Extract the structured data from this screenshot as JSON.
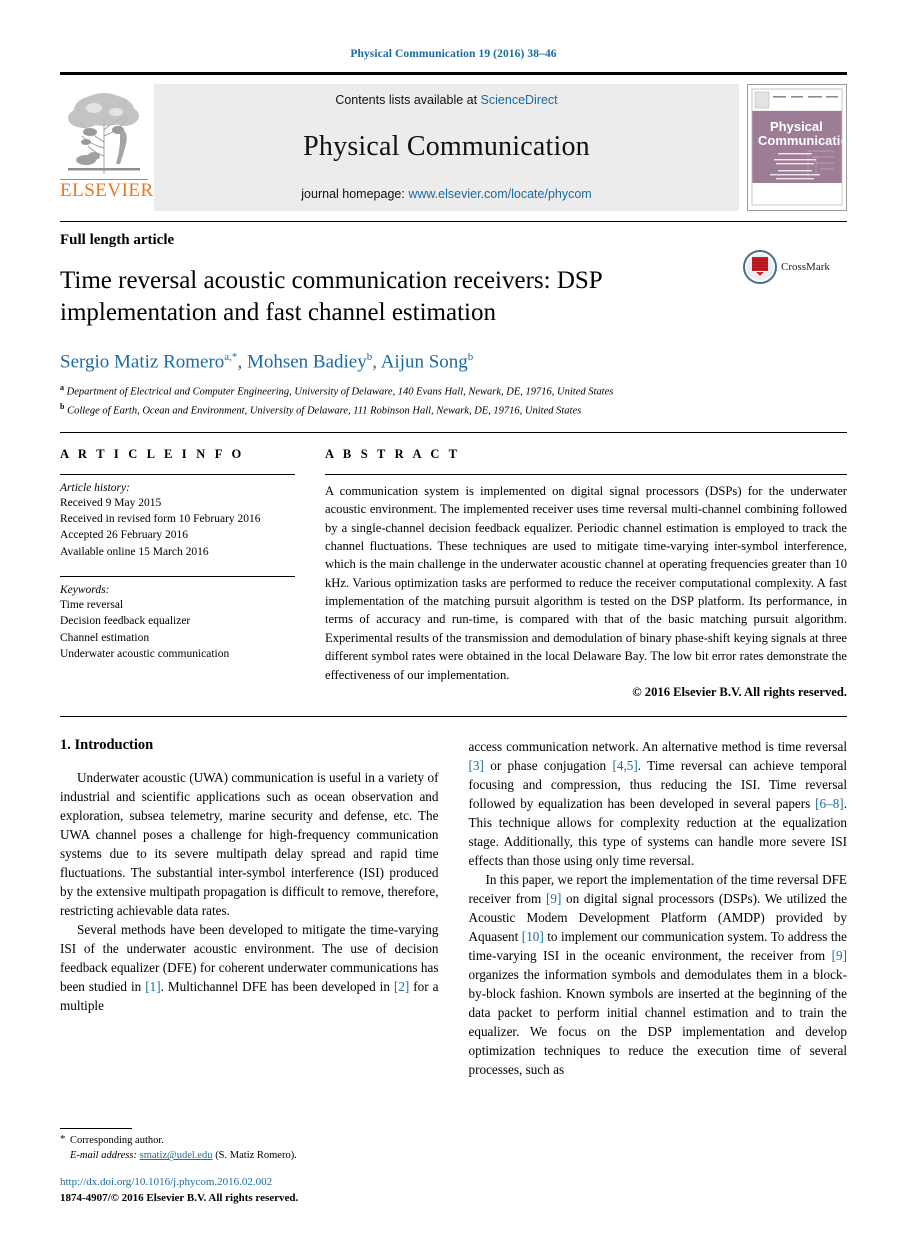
{
  "running_head": "Physical Communication 19 (2016) 38–46",
  "masthead": {
    "publisher_name": "ELSEVIER",
    "contents_prefix": "Contents lists available at ",
    "contents_link": "ScienceDirect",
    "journal_title": "Physical Communication",
    "homepage_prefix": "journal homepage: ",
    "homepage_link": "www.elsevier.com/locate/phycom",
    "cover_title_line1": "Physical",
    "cover_title_line2": "Communication"
  },
  "title_block": {
    "article_type": "Full length article",
    "title": "Time reversal acoustic communication receivers: DSP implementation and fast channel estimation",
    "crossmark_label": "CrossMark",
    "authors": "Sergio Matiz Romero",
    "author2": "Mohsen Badiey",
    "author3": "Aijun Song",
    "affiliation_a": "Department of Electrical and Computer Engineering, University of Delaware, 140 Evans Hall, Newark, DE, 19716, United States",
    "affiliation_b": "College of Earth, Ocean and Environment, University of Delaware, 111 Robinson Hall, Newark, DE, 19716, United States"
  },
  "article_info": {
    "heading": "A R T I C L E   I N F O",
    "history_label": "Article history:",
    "history": [
      "Received 9 May 2015",
      "Received in revised form 10 February 2016",
      "Accepted 26 February 2016",
      "Available online 15 March 2016"
    ],
    "keywords_label": "Keywords:",
    "keywords": [
      "Time reversal",
      "Decision feedback equalizer",
      "Channel estimation",
      "Underwater acoustic communication"
    ]
  },
  "abstract": {
    "heading": "A B S T R A C T",
    "text": "A communication system is implemented on digital signal processors (DSPs) for the underwater acoustic environment. The implemented receiver uses time reversal multi-channel combining followed by a single-channel decision feedback equalizer. Periodic channel estimation is employed to track the channel fluctuations. These techniques are used to mitigate time-varying inter-symbol interference, which is the main challenge in the underwater acoustic channel at operating frequencies greater than 10 kHz. Various optimization tasks are performed to reduce the receiver computational complexity. A fast implementation of the matching pursuit algorithm is tested on the DSP platform. Its performance, in terms of accuracy and run-time, is compared with that of the basic matching pursuit algorithm. Experimental results of the transmission and demodulation of binary phase-shift keying signals at three different symbol rates were obtained in the local Delaware Bay. The low bit error rates demonstrate the effectiveness of our implementation.",
    "copyright": "© 2016 Elsevier B.V. All rights reserved."
  },
  "body": {
    "section_heading": "1. Introduction",
    "left_para1_a": "Underwater acoustic (UWA) communication is useful in a variety of industrial and scientific applications such as ocean observation and exploration, subsea telemetry, marine security and defense, etc. The UWA channel poses a challenge for high-frequency communication systems due to its severe multipath delay spread and rapid time fluctuations. The substantial inter-symbol interference (ISI) produced by the extensive multipath propagation is difficult to remove, therefore, restricting achievable data rates.",
    "left_para2_a": "Several methods have been developed to mitigate the time-varying ISI of the underwater acoustic environment. The use of decision feedback equalizer (DFE) for coherent underwater communications has been studied in ",
    "left_cite1": "[1]",
    "left_para2_b": ". Multichannel DFE has been developed in ",
    "left_cite2": "[2]",
    "left_para2_c": " for a multiple",
    "right_para1_a": "access communication network. An alternative method is time reversal ",
    "right_cite3": "[3]",
    "right_para1_b": " or phase conjugation ",
    "right_cite45": "[4,5]",
    "right_para1_c": ". Time reversal can achieve temporal focusing and compression, thus reducing the ISI. Time reversal followed by equalization has been developed in several papers ",
    "right_cite68": "[6–8]",
    "right_para1_d": ". This technique allows for complexity reduction at the equalization stage. Additionally, this type of systems can handle more severe ISI effects than those using only time reversal.",
    "right_para2_a": "In this paper, we report the implementation of the time reversal DFE receiver from ",
    "right_cite9": "[9]",
    "right_para2_b": " on digital signal processors (DSPs). We utilized the Acoustic Modem Development Platform (AMDP) provided by Aquasent ",
    "right_cite10": "[10]",
    "right_para2_c": " to implement our communication system. To address the time-varying ISI in the oceanic environment, the receiver from ",
    "right_cite9b": "[9]",
    "right_para2_d": " organizes the information symbols and demodulates them in a block-by-block fashion. Known symbols are inserted at the beginning of the data packet to perform initial channel estimation and to train the equalizer. We focus on the DSP implementation and develop optimization techniques to reduce the execution time of several processes, such as"
  },
  "footnote": {
    "star": "*",
    "corresponding": "Corresponding author.",
    "email_label": "E-mail address:",
    "email": "smatiz@udel.edu",
    "email_suffix": "(S. Matiz Romero).",
    "doi": "http://dx.doi.org/10.1016/j.phycom.2016.02.002",
    "issn": "1874-4907/© 2016 Elsevier B.V. All rights reserved."
  },
  "colors": {
    "link": "#1a6ba0",
    "elsevier_orange": "#e87722",
    "cover_mauve": "#9d7d95"
  }
}
